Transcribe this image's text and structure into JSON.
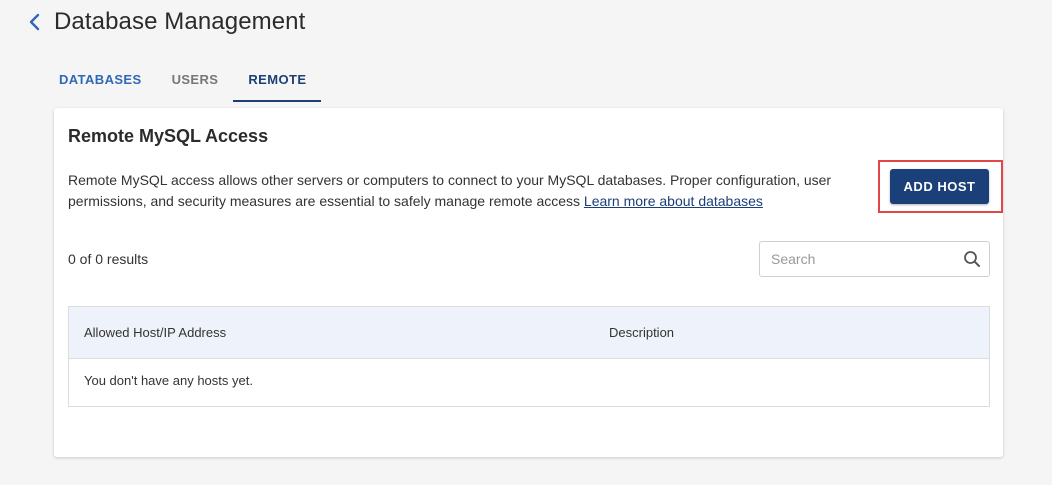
{
  "header": {
    "title": "Database Management"
  },
  "tabs": [
    {
      "label": "DATABASES"
    },
    {
      "label": "USERS"
    },
    {
      "label": "REMOTE"
    }
  ],
  "card": {
    "title": "Remote MySQL Access",
    "description": "Remote MySQL access allows other servers or computers to connect to your MySQL databases. Proper configuration, user permissions, and security measures are essential to safely manage remote access",
    "learn_more": "Learn more about databases",
    "add_button": "ADD HOST",
    "results": "0 of 0 results",
    "search_placeholder": "Search",
    "table": {
      "columns": [
        "Allowed Host/IP Address",
        "Description"
      ],
      "empty_message": "You don't have any hosts yet."
    }
  },
  "colors": {
    "primary": "#1b3f78",
    "link": "#2f68b8",
    "highlight": "#e04848",
    "table_header_bg": "#eef2fa"
  }
}
